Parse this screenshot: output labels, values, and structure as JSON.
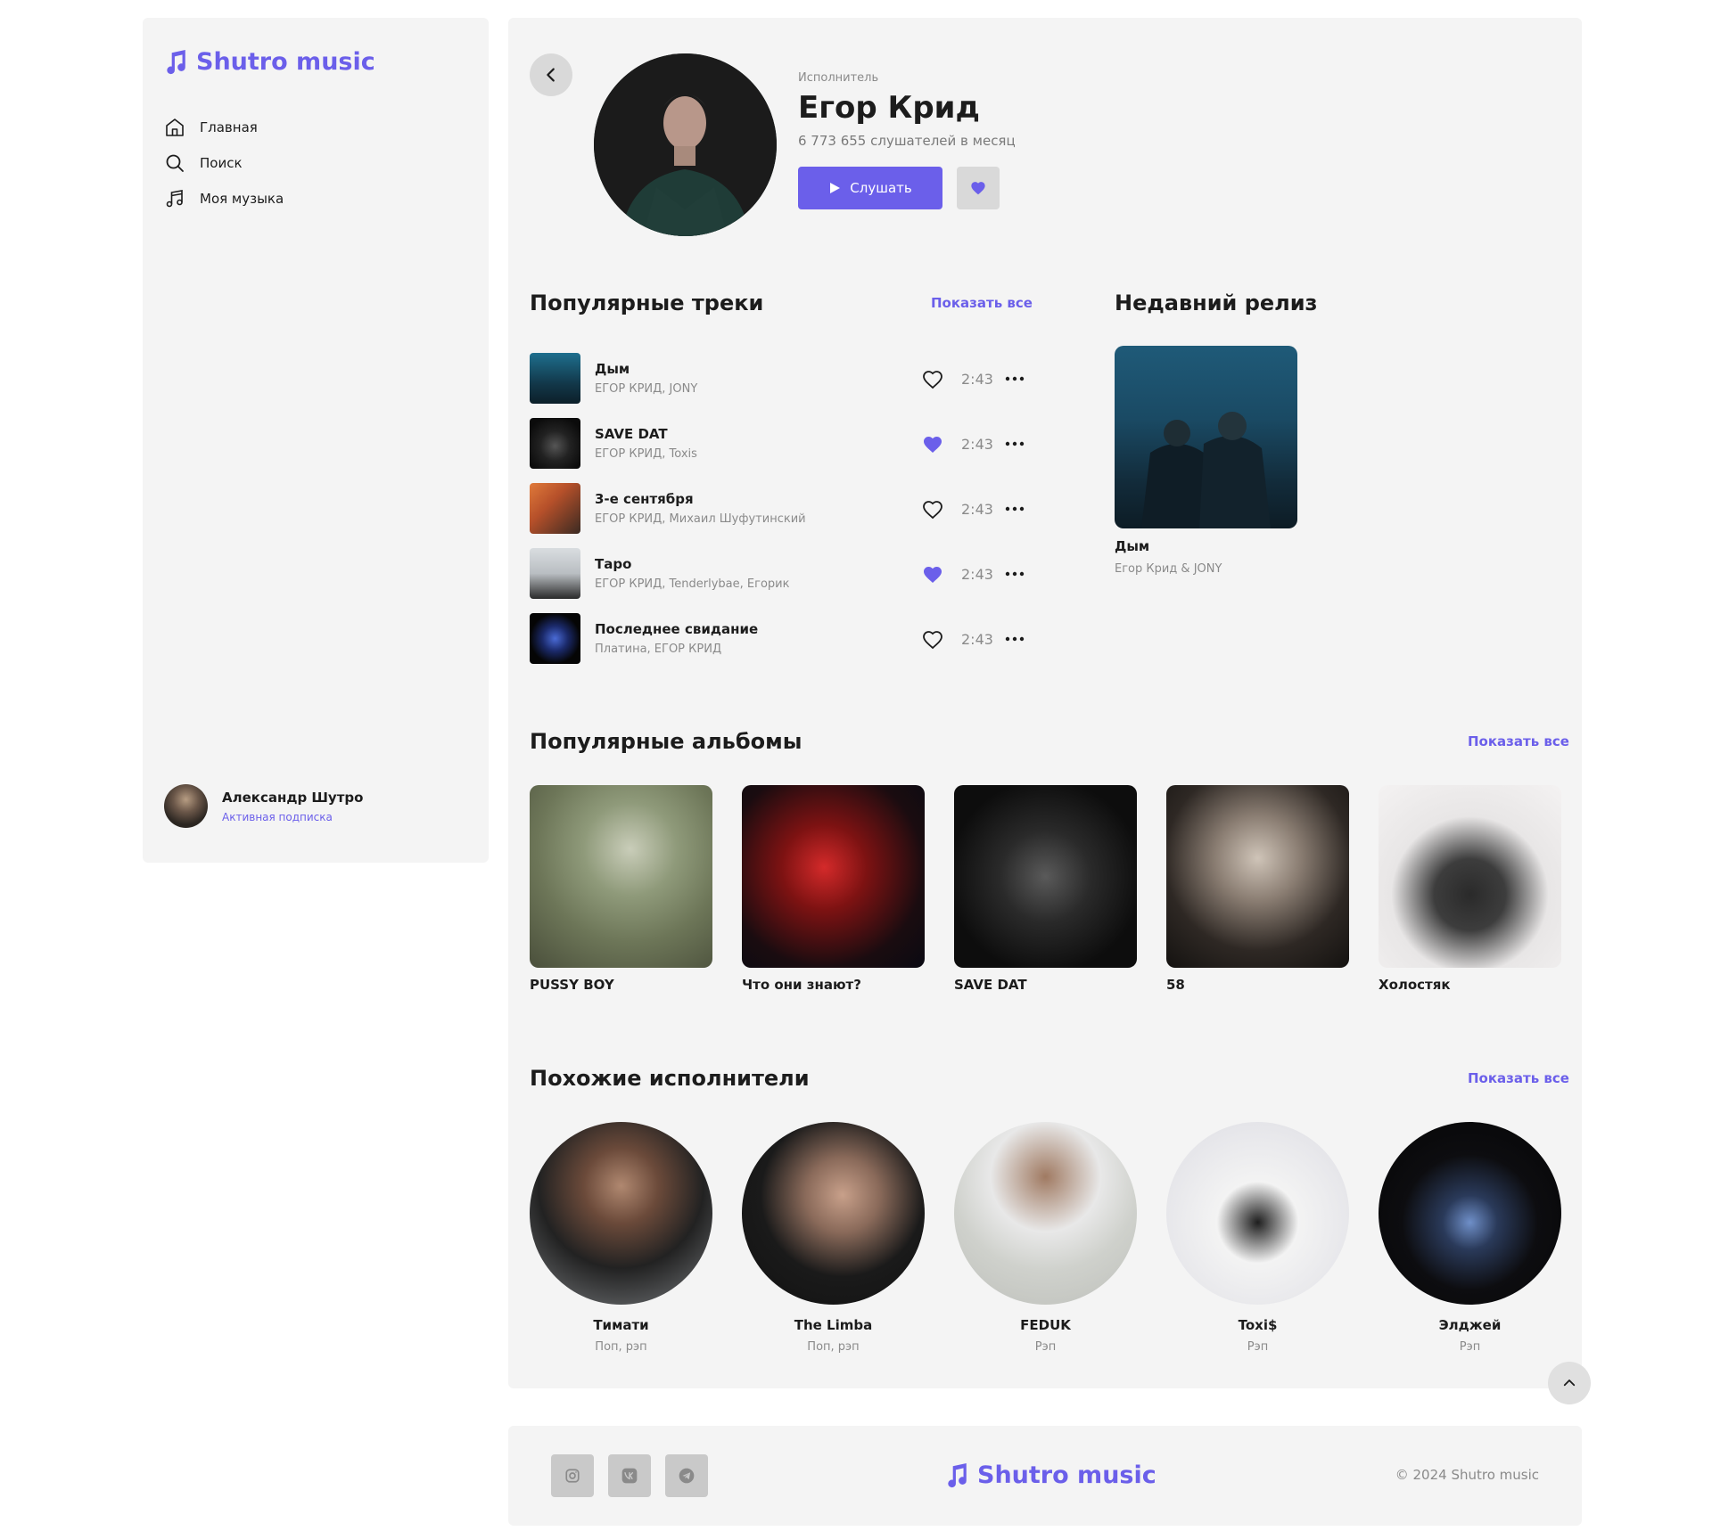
{
  "app": {
    "name": "Shutro music",
    "accent_color": "#6b5fea"
  },
  "sidebar": {
    "nav": [
      {
        "label": "Главная",
        "icon": "home-icon"
      },
      {
        "label": "Поиск",
        "icon": "search-icon"
      },
      {
        "label": "Моя музыка",
        "icon": "music-note-icon"
      }
    ],
    "user": {
      "name": "Александр Шутро",
      "status": "Активная подписка"
    }
  },
  "artist": {
    "label": "Исполнитель",
    "name": "Егор Крид",
    "listeners": "6 773 655 слушателей в месяц",
    "listen_button": "Слушать"
  },
  "popular_tracks": {
    "title": "Популярные треки",
    "show_all": "Показать все",
    "items": [
      {
        "title": "Дым",
        "artists": "ЕГОР КРИД, JONY",
        "duration": "2:43",
        "liked": false
      },
      {
        "title": "SAVE DAT",
        "artists": "ЕГОР КРИД, Toxis",
        "duration": "2:43",
        "liked": true
      },
      {
        "title": "3-е сентября",
        "artists": "ЕГОР КРИД, Михаил Шуфутинский",
        "duration": "2:43",
        "liked": false
      },
      {
        "title": "Таро",
        "artists": "ЕГОР КРИД, Tenderlybae, Егорик",
        "duration": "2:43",
        "liked": true
      },
      {
        "title": "Последнее свидание",
        "artists": "Платина, ЕГОР КРИД",
        "duration": "2:43",
        "liked": false
      }
    ]
  },
  "recent_release": {
    "title": "Недавний релиз",
    "name": "Дым",
    "artists": "Егор Крид & JONY"
  },
  "popular_albums": {
    "title": "Популярные альбомы",
    "show_all": "Показать все",
    "items": [
      {
        "title": "PUSSY BOY"
      },
      {
        "title": "Что они знают?"
      },
      {
        "title": "SAVE DAT"
      },
      {
        "title": "58"
      },
      {
        "title": "Холостяк"
      }
    ]
  },
  "similar_artists": {
    "title": "Похожие исполнители",
    "show_all": "Показать все",
    "items": [
      {
        "name": "Тимати",
        "genre": "Поп, рэп"
      },
      {
        "name": "The Limba",
        "genre": "Поп, рэп"
      },
      {
        "name": "FEDUK",
        "genre": "Рэп"
      },
      {
        "name": "Toxi$",
        "genre": "Рэп"
      },
      {
        "name": "Элджей",
        "genre": "Рэп"
      }
    ]
  },
  "footer": {
    "socials": [
      "instagram-icon",
      "vk-icon",
      "telegram-icon"
    ],
    "copyright": "© 2024 Shutro music"
  }
}
